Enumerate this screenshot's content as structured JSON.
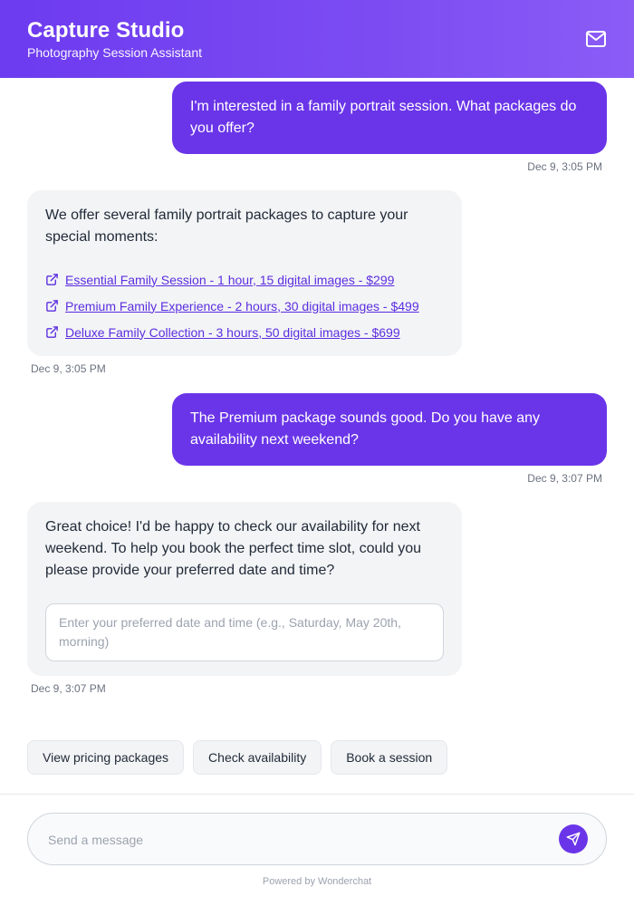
{
  "header": {
    "title": "Capture Studio",
    "subtitle": "Photography Session Assistant",
    "icon": "mail-icon"
  },
  "messages": [
    {
      "role": "user",
      "text": "I'm interested in a family portrait session. What packages do you offer?",
      "timestamp": "Dec 9, 3:05 PM"
    },
    {
      "role": "assistant",
      "text": "We offer several family portrait packages to capture your special moments:",
      "links": [
        "Essential Family Session - 1 hour, 15 digital images - $299",
        "Premium Family Experience - 2 hours, 30 digital images - $499",
        "Deluxe Family Collection - 3 hours, 50 digital images - $699"
      ],
      "link_icon": "external-link-icon",
      "timestamp": "Dec 9, 3:05 PM"
    },
    {
      "role": "user",
      "text": "The Premium package sounds good. Do you have any availability next weekend?",
      "timestamp": "Dec 9, 3:07 PM"
    },
    {
      "role": "assistant",
      "text": "Great choice! I'd be happy to check our availability for next weekend. To help you book the perfect time slot, could you please provide your preferred date and time?",
      "input_placeholder": "Enter your preferred date and time (e.g., Saturday, May 20th, morning)",
      "timestamp": "Dec 9, 3:07 PM"
    }
  ],
  "quick_replies": [
    "View pricing packages",
    "Check availability",
    "Book a session"
  ],
  "composer": {
    "placeholder": "Send a message",
    "send_icon": "send-icon"
  },
  "footer": {
    "powered_by": "Powered by Wonderchat"
  },
  "colors": {
    "accent": "#6a35e8",
    "header_gradient_start": "#6d3bf0",
    "header_gradient_end": "#8b5cf6",
    "bot_bubble": "#f3f4f6",
    "link": "#5b2ee0"
  }
}
